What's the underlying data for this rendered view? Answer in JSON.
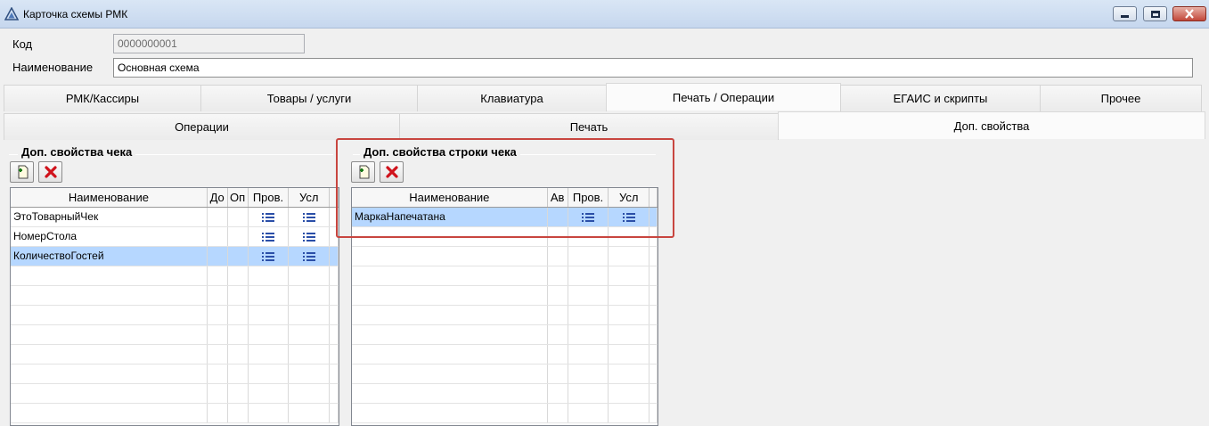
{
  "window": {
    "title": "Карточка схемы РМК"
  },
  "form": {
    "code_label": "Код",
    "code_value": "0000000001",
    "name_label": "Наименование",
    "name_value": "Основная схема"
  },
  "main_tabs": [
    {
      "label": "РМК/Кассиры",
      "active": false
    },
    {
      "label": "Товары / услуги",
      "active": false
    },
    {
      "label": "Клавиатура",
      "active": false
    },
    {
      "label": "Печать / Операции",
      "active": true
    },
    {
      "label": "ЕГАИС и скрипты",
      "active": false
    },
    {
      "label": "Прочее",
      "active": false
    }
  ],
  "sub_tabs": [
    {
      "label": "Операции",
      "active": false
    },
    {
      "label": "Печать",
      "active": false
    },
    {
      "label": "Доп. свойства",
      "active": true
    }
  ],
  "receipt_props": {
    "title": "Доп. свойства чека",
    "columns": [
      "Наименование",
      "До",
      "Оп",
      "Пров.",
      "Усл"
    ],
    "rows": [
      {
        "name": "ЭтоТоварныйЧек",
        "selected": false
      },
      {
        "name": "НомерСтола",
        "selected": false
      },
      {
        "name": "КоличествоГостей",
        "selected": true
      }
    ]
  },
  "line_props": {
    "title": "Доп. свойства строки чека",
    "columns": [
      "Наименование",
      "Ав",
      "Пров.",
      "Усл"
    ],
    "rows": [
      {
        "name": "МаркаНапечатана",
        "selected": true
      }
    ]
  },
  "colors": {
    "selection": "#b6d7ff",
    "highlight_frame": "#c8453f",
    "icon_blue": "#2b4fa8"
  },
  "icons": {
    "add": "add-document-icon",
    "delete": "delete-x-icon",
    "list": "list-icon"
  }
}
